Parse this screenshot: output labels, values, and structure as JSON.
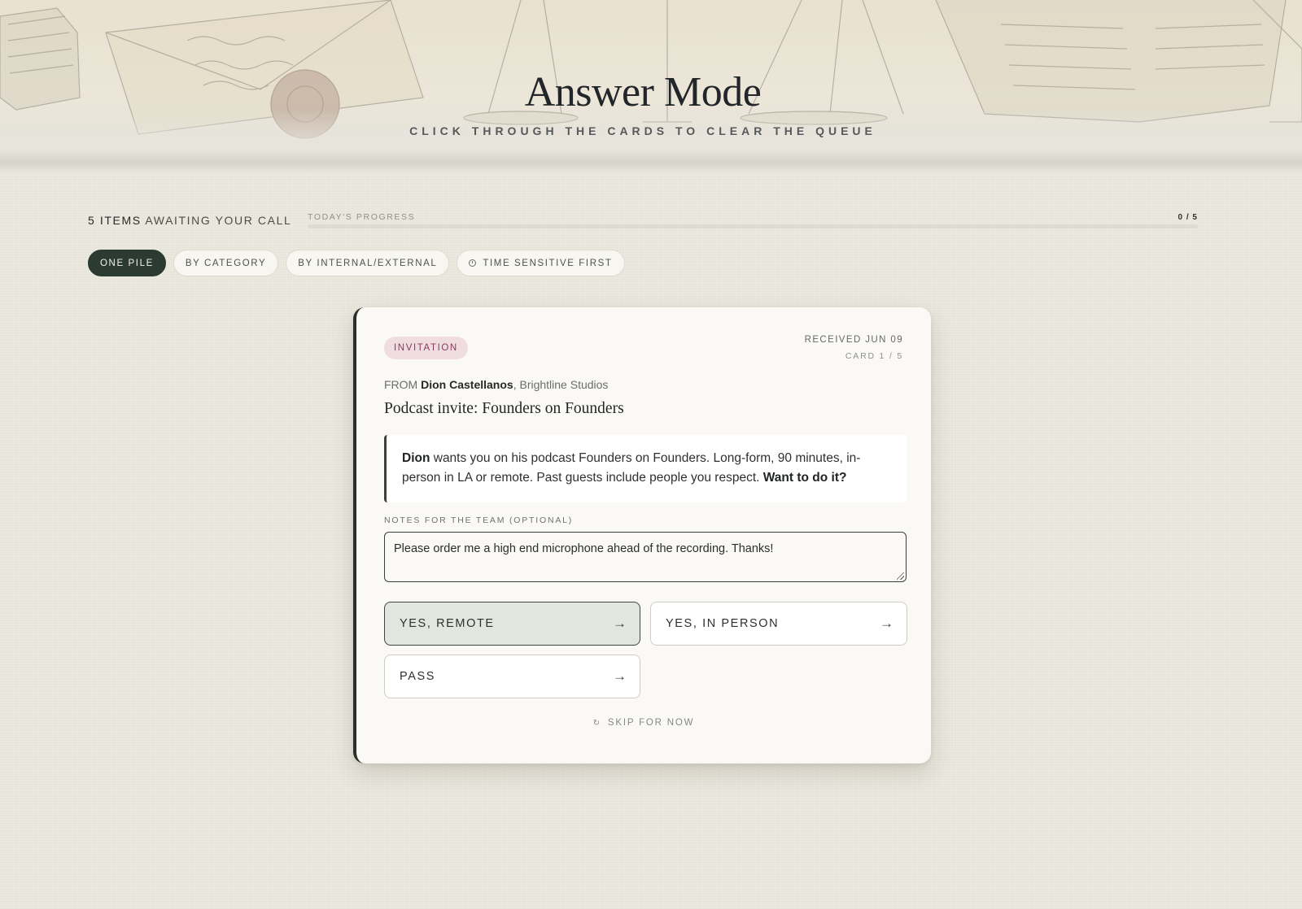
{
  "header": {
    "title": "Answer Mode",
    "subtitle": "CLICK THROUGH THE CARDS TO CLEAR THE QUEUE"
  },
  "status": {
    "items_count": "5 ITEMS",
    "items_suffix": "AWAITING YOUR CALL",
    "progress_label": "TODAY'S PROGRESS",
    "progress_text": "0 / 5",
    "progress_fraction": 0
  },
  "filters": [
    {
      "label": "ONE PILE",
      "active": true
    },
    {
      "label": "BY CATEGORY",
      "active": false
    },
    {
      "label": "BY INTERNAL/EXTERNAL",
      "active": false
    },
    {
      "label": "TIME SENSITIVE FIRST",
      "active": false,
      "icon": "clock-icon"
    }
  ],
  "card": {
    "category": "INVITATION",
    "received": "RECEIVED JUN 09",
    "index": "CARD 1 / 5",
    "from_prefix": "FROM",
    "sender_name": "Dion Castellanos",
    "sender_org": ", Brightline Studios",
    "subject": "Podcast invite: Founders on Founders",
    "message": {
      "lead": "Dion",
      "body": " wants you on his podcast Founders on Founders. Long-form, 90 minutes, in-person in LA or remote. Past guests include people you respect. ",
      "question": "Want to do it?"
    },
    "notes_label": "NOTES FOR THE TEAM (OPTIONAL)",
    "notes_value": "Please order me a high end microphone ahead of the recording. Thanks!",
    "choices": [
      {
        "label": "YES, REMOTE",
        "arrow": "→",
        "selected": true
      },
      {
        "label": "YES, IN PERSON",
        "arrow": "→",
        "selected": false
      },
      {
        "label": "PASS",
        "arrow": "→",
        "selected": false
      }
    ],
    "skip_icon": "↻",
    "skip_label": "SKIP FOR NOW"
  },
  "colors": {
    "background": "#ece9e0",
    "accent_dark": "#2c3b31",
    "badge_bg": "#efdde2",
    "badge_text": "#8c3a58"
  }
}
